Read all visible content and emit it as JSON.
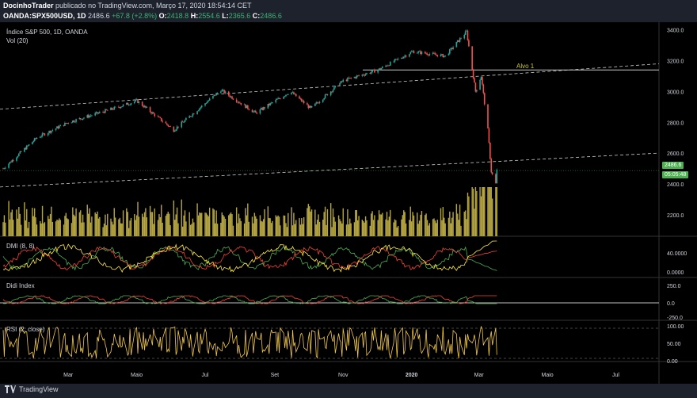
{
  "header": {
    "author": "DocinhoTrader",
    "published": "publicado no TradingView.com, Março 17, 2020 18:54:14 CET",
    "symbol": "OANDA:SPX500USD, 1D",
    "last": "2486.6",
    "change": "+67.8 (+2.8%)",
    "o_label": "O:",
    "o_value": "2418.8",
    "h_label": "H:",
    "h_value": "2554.6",
    "l_label": "L:",
    "l_value": "2365.6",
    "c_label": "C:",
    "c_value": "2486.6"
  },
  "panes": {
    "main_title": "Índice S&P 500, 1D, OANDA",
    "vol_title": "Vol (20)",
    "dmi_title": "DMI (8, 8)",
    "didi_title": "Didi Index",
    "rsi_title": "RSI (2, close)"
  },
  "tags": {
    "price": "2486.6",
    "countdown": "05:05:48",
    "alvo": "Alvo 1"
  },
  "footer": {
    "brand": "TradingView"
  },
  "colors": {
    "up": "#26a69a",
    "down": "#ef5350",
    "volume": "#b5a642",
    "hline": "#c8c8c8",
    "dmi_plus": "#4caf50",
    "dmi_minus": "#f44336",
    "adx": "#ffeb3b",
    "rsi": "#f2c94c",
    "tag": "#4caf50"
  },
  "chart_data": [
    {
      "type": "candlestick",
      "title": "Índice S&P 500, 1D, OANDA",
      "y_ticks": [
        "3400.0",
        "3200.0",
        "3000.0",
        "2800.0",
        "2600.0",
        "2400.0",
        "2200.0"
      ],
      "ylim": [
        2060,
        3450
      ],
      "x_ticks": [
        "Mar",
        "Maio",
        "Jul",
        "Set",
        "Nov",
        "2020",
        "Mar",
        "Maio",
        "Jul"
      ],
      "x_tick_dates": [
        "2019-03-01",
        "2019-05-01",
        "2019-07-01",
        "2019-09-01",
        "2019-11-01",
        "2020-01-01",
        "2020-03-01",
        "2020-05-01",
        "2020-07-01"
      ],
      "closes_approx": [
        {
          "date": "2019-01-02",
          "value": 2500
        },
        {
          "date": "2019-02-01",
          "value": 2700
        },
        {
          "date": "2019-03-01",
          "value": 2800
        },
        {
          "date": "2019-04-15",
          "value": 2900
        },
        {
          "date": "2019-05-01",
          "value": 2940
        },
        {
          "date": "2019-06-03",
          "value": 2750
        },
        {
          "date": "2019-07-15",
          "value": 3010
        },
        {
          "date": "2019-08-15",
          "value": 2860
        },
        {
          "date": "2019-09-15",
          "value": 3000
        },
        {
          "date": "2019-10-03",
          "value": 2890
        },
        {
          "date": "2019-11-01",
          "value": 3070
        },
        {
          "date": "2019-12-02",
          "value": 3140
        },
        {
          "date": "2020-01-02",
          "value": 3260
        },
        {
          "date": "2020-01-31",
          "value": 3230
        },
        {
          "date": "2020-02-19",
          "value": 3390
        },
        {
          "date": "2020-02-27",
          "value": 3000
        },
        {
          "date": "2020-03-03",
          "value": 3100
        },
        {
          "date": "2020-03-09",
          "value": 2750
        },
        {
          "date": "2020-03-12",
          "value": 2480
        },
        {
          "date": "2020-03-16",
          "value": 2400
        },
        {
          "date": "2020-03-17",
          "value": 2486.6
        }
      ],
      "horizontal_line": {
        "label": "Alvo 1",
        "value": 3140
      },
      "last_price": 2486.6
    },
    {
      "type": "bar",
      "title": "Vol (20)",
      "note": "volume bars, relative heights only"
    },
    {
      "type": "line",
      "title": "DMI (8, 8)",
      "y_ticks": [
        "40.0000",
        "0.0000"
      ],
      "series": [
        {
          "name": "+DI"
        },
        {
          "name": "-DI"
        },
        {
          "name": "ADX"
        }
      ]
    },
    {
      "type": "line",
      "title": "Didi Index",
      "y_ticks": [
        "250.0",
        "0.0",
        "-250.0"
      ]
    },
    {
      "type": "line",
      "title": "RSI (2, close)",
      "y_ticks": [
        "100.00",
        "50.00",
        "0.00"
      ]
    }
  ]
}
